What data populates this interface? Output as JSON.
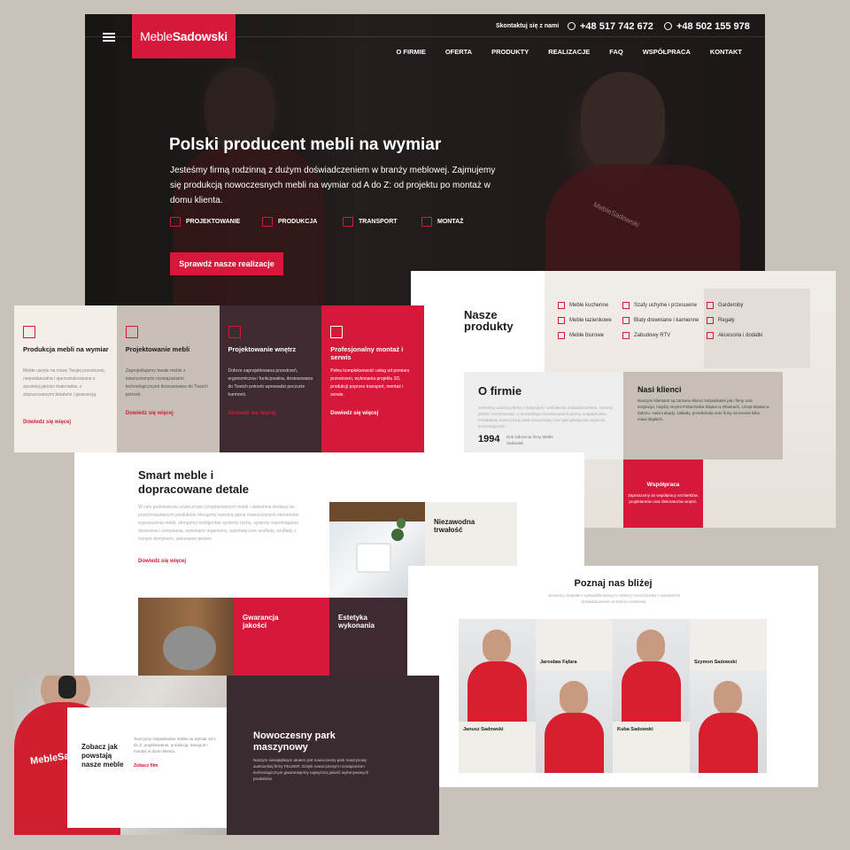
{
  "hero": {
    "logo_a": "Meble",
    "logo_b": "Sadowski",
    "contact_label": "Skontaktuj się z nami",
    "phone1": "+48 517 742 672",
    "phone2": "+48 502 155 978",
    "nav": [
      "O FIRMIE",
      "OFERTA",
      "PRODUKTY",
      "REALIZACJE",
      "FAQ",
      "WSPÓŁPRACA",
      "KONTAKT"
    ],
    "title": "Polski producent mebli na wymiar",
    "lead": "Jesteśmy firmą rodzinną z dużym doświadczeniem w branży meblowej. Zajmujemy się produkcją nowoczesnych mebli na wymiar od A do Z: od projektu po montaż w domu klienta.",
    "services": [
      "PROJEKTOWANIE",
      "PRODUKCJA",
      "TRANSPORT",
      "MONTAŻ"
    ],
    "cta": "Sprawdź nasze realizacje",
    "shirt_logo": "MebleSadowski"
  },
  "products": {
    "title_a": "Nasze",
    "title_b": "produkty",
    "col1": [
      "Meble kuchenne",
      "Meble łazienkowe",
      "Meble biurowe"
    ],
    "col2": [
      "Szafy uchylne i przesuwne",
      "Blaty drewniane i kamienne",
      "Zabudowy RTV"
    ],
    "col3": [
      "Garderoby",
      "Regały",
      "Akcesoria i dodatki"
    ]
  },
  "about": {
    "title": "O firmie",
    "text": "Jesteśmy rodzinną firmą z tradycjami i wieloletnim doświadczeniem. Cenimy jakość i terminowość, a do każdego zlecenia podchodzimy indywidualnie. Posiadamy nowoczesny park maszynowy oraz specjalistyczne zaplecze technologiczne.",
    "year": "1994",
    "year_text": "Rok założenia firmy Meble Sadowski",
    "clients_title": "Nasi klienci",
    "clients_text": "Naszymi klientami są zarówno klienci indywidualni jak i firmy oraz instytucje, między innymi Politechnika Śląska w Gliwicach, Urząd Miasta w Zabrzu, Huta Łabędy, zakłady, przedszkola oraz firmy na terenie kilku miast śląskich.",
    "coop_title": "Współpraca",
    "coop_text": "Zapraszamy do współpracy architektów, projektantów oraz dekoratorów wnętrz."
  },
  "cards": [
    {
      "title": "Produkcja mebli na wymiar",
      "text": "Meble uszyte na miarę Twojej przestrzeni, niepowtarzalne i spersonalizowane z wysokiej jakości materiałów, z dopracowanymi detalami i gwarancją.",
      "link": "Dowiedz się więcej",
      "bg": "#f3efe8",
      "fg": "#1a1a1a",
      "muted": "#888888"
    },
    {
      "title": "Projektowanie mebli",
      "text": "Zaprojektujemy trwałe meble z nowoczesnymi rozwiązaniami technologicznymi dostosowane do Twoich potrzeb.",
      "link": "Dowiedz się więcej",
      "bg": "#c8bfb7",
      "fg": "#1a1a1a",
      "muted": "#555555"
    },
    {
      "title": "Projektowanie wnętrz",
      "text": "Dobrze zaprojektowana przestrzeń, ergonomiczna i funkcjonalna, dostosowana do Twoich potrzeb wprowadzi poczucie harmonii.",
      "link": "Dowiedz się więcej",
      "bg": "#3d2b31",
      "fg": "#ffffff",
      "muted": "#e0d2d6"
    },
    {
      "title": "Profesjonalny montaż i serwis",
      "text": "Pełna kompleksowość usług od pomiaru przestrzeni, wykonania projektu 3D, produkcji poprzez transport, montaż i serwis.",
      "link": "Dowiedz się więcej",
      "bg": "#d6193a",
      "fg": "#ffffff",
      "muted": "#ffffff"
    }
  ],
  "smart": {
    "title": "Smart meble i dopracowane detale",
    "text": "W celu podniesienia użyteczności projektowanych mebli i ułatwienia dostępu do przechowywanych produktów oferujemy szeroką gamę nowoczesnych elementów wyposażenia mebli, oferujemy inteligentne systemy ruchu, systemy wspomagania otwierania i zamykania, wykonane organizery, automatyczne szuflady, szuflady z cichym domykiem, stelowanie płotem.",
    "link": "Dowiedz się więcej",
    "durability": "Niezawodna trwałość",
    "quality": "Gwarancja jakości",
    "aesthetics": "Estetyka wykonania"
  },
  "team": {
    "title": "Poznaj nas bliżej",
    "subtitle": "Jesteśmy zespołem wykwalifikowanych stolarzy montażystów z wieloletnim doświadczeniem w branży meblowej.",
    "members": [
      "Janusz Sadowski",
      "Jarosław Fąfara",
      "Kuba Sadowski",
      "Szymon Sadowski"
    ]
  },
  "film": {
    "title": "Zobacz jak powstają nasze meble",
    "text": "Tworzymy indywidualne meble na wymiar od A do Z: projektowanie, produkcja, transport i montaż w domu klienta.",
    "link": "Zobacz film",
    "shirt_logo": "MebleSa",
    "machines_title": "Nowoczesny park maszynowy",
    "machines_text": "Naszym niewątpliwym atutem jest nowoczesny park maszynowy austriackiej firmy FELDER. Dzięki nowoczesnym rozwiązaniom technologicznym gwarantujemy najwyższą jakość wykonywanych produktów."
  }
}
